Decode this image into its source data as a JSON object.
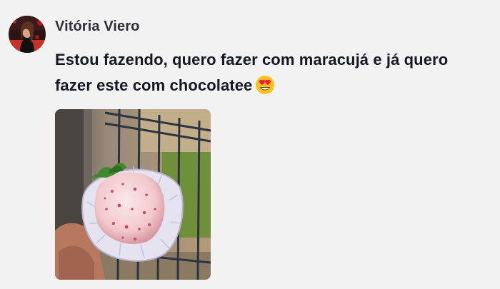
{
  "comment": {
    "author": "Vitória Viero",
    "text": "Estou fazendo, quero fazer com maracujá e já quero fazer este com chocolatee",
    "emoji": "heart-eyes-emoji"
  },
  "colors": {
    "background": "#f2f2f2",
    "text": "#161823"
  }
}
